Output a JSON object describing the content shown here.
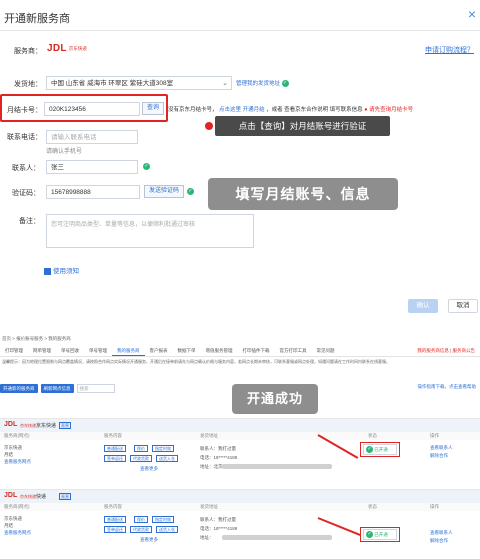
{
  "dialog": {
    "title": "开通新服务商",
    "close": "×",
    "labels": {
      "provider": "服务商：",
      "ship_addr": "发货地：",
      "account": "月结卡号：",
      "phone": "联系电话：",
      "contact": "联系人：",
      "code": "验证码：",
      "remark": "备注："
    },
    "provider_logo": "JDL",
    "provider_logo_sub": "京东快递",
    "help_link": "申请订购流程？",
    "address_value": "中国 山东省 威海市 环翠区 紫硅大道308室",
    "manage_address_link": "管理我的发货地址",
    "account_value": "020K123456",
    "query_button": "查询",
    "account_hint_a": "没有京东月结卡号，",
    "account_hint_link_a": "点击这里 开通月结",
    "account_hint_b": "，或者 查看京东合作说明",
    "account_hint_c": "填写联系信息",
    "account_hint_err": "请先查询月结卡号",
    "tooltip": "点击【查询】对月结账号进行验证",
    "phone_placeholder": "请输入联系电话",
    "phone_confirm": "请确认手机号",
    "contact_value": "张三",
    "code_value": "15678998888",
    "send_code_button": "发送验证码",
    "callout": "填写月结账号、信息",
    "remark_placeholder": "您可注明商品类型、单量等信息，以便顺利批通过审核",
    "agree_text": "使用须知",
    "confirm_button": "确认",
    "cancel_button": "取消"
  },
  "page": {
    "breadcrumb": "首页 > 报价账号服务 > 我的服务商",
    "tabs": [
      "打印管理",
      "网单管理",
      "单号回收",
      "单号管理",
      "我的服务商",
      "客户报表",
      "数据下单",
      "增值服务管理",
      "打印插件下载",
      "官方打印工具",
      "常见问题"
    ],
    "tab_right": "我的服务商信息 | 服务商公告",
    "notice": "温馨提示：因为地理位置限制与网点覆盖情况，请按照合作网点实际情况开通服务，开通后在接单前请先与网点确认价格与服务内容，若网点长期未审核，可联系客服或网点处理，如遇问题请在工作时间内联系在线客服。",
    "btn_open": "开通新的服务商",
    "btn_refresh": "刷新网点信息",
    "search_placeholder": "搜索",
    "guide_link": "操作指南下载，点击查看帮助",
    "success": "开通成功",
    "col_headers": [
      "服务商(网点)",
      "服务内容",
      "发货地址",
      "状态",
      "操作"
    ],
    "cards": [
      {
        "logo": "JDL",
        "logo_sub": "京东快递",
        "name": "京东快递",
        "tag": "直营",
        "left_lines": [
          "京东快递",
          "月结",
          "查看服务网点"
        ],
        "services": [
          "普通配送",
          "保价",
          "指定时效",
          "签单返还",
          "代收货款",
          "送货入仓"
        ],
        "more_services": "查看更多",
        "contact_line": "联系人：我打过量",
        "phone_line": "电话：18*****4189",
        "addr_line": "地址：北京",
        "status": "已开通",
        "ops": [
          "查看联系人",
          "解除合作"
        ]
      },
      {
        "logo": "JDL",
        "logo_sub": "京东快递",
        "name": "快递",
        "tag": "直营",
        "left_lines": [
          "京东快递",
          "月结",
          "查看服务网点"
        ],
        "services": [
          "普通配送",
          "保价",
          "指定时效",
          "签单返还",
          "代收货款",
          "送货入仓"
        ],
        "more_services": "查看更多",
        "contact_line": "联系人：我打过量",
        "phone_line": "电话：18*****4189",
        "addr_line": "地址：",
        "status": "已开通",
        "ops": [
          "查看联系人",
          "解除合作"
        ]
      }
    ]
  },
  "colors": {
    "accent": "#2d6fd3",
    "danger": "#e02424",
    "success": "#2bb673",
    "brand_jd": "#d52b1e",
    "callout_bg": "#8e8e8e"
  }
}
